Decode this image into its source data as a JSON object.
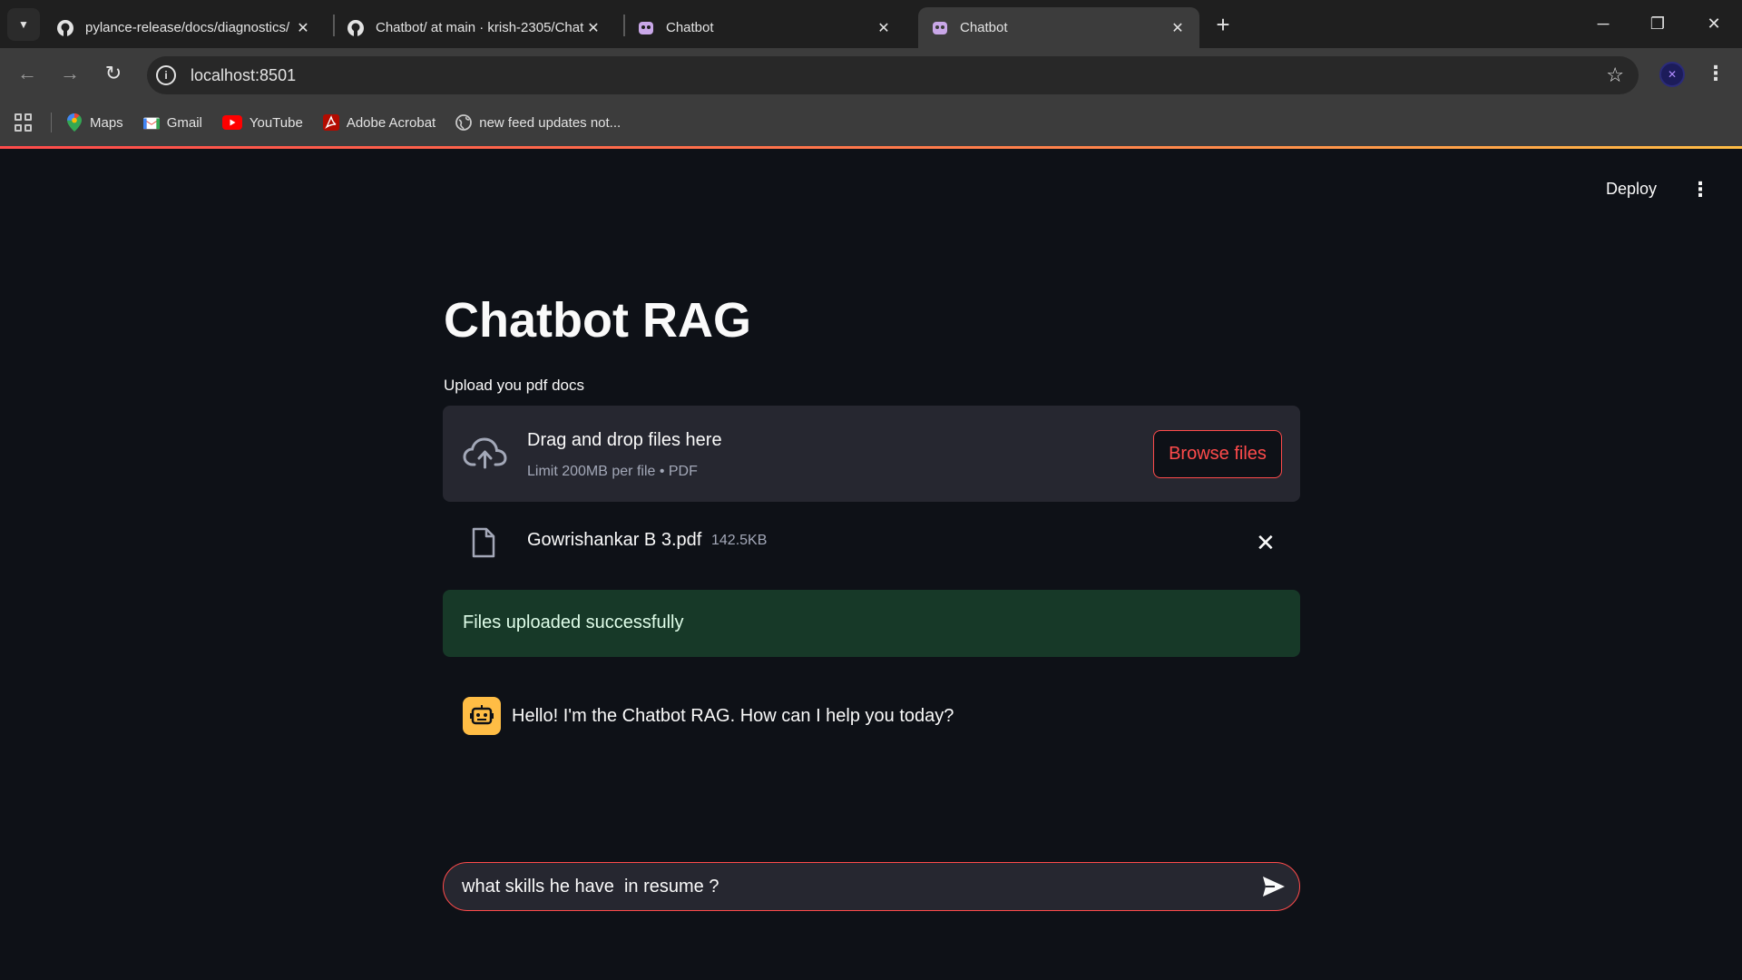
{
  "browser": {
    "tabs": [
      {
        "title": "pylance-release/docs/diagnostics/",
        "icon": "github-icon",
        "active": false
      },
      {
        "title": "Chatbot/ at main · krish-2305/Chat",
        "icon": "github-icon",
        "active": false
      },
      {
        "title": "Chatbot",
        "icon": "chatbot-icon",
        "active": false
      },
      {
        "title": "Chatbot",
        "icon": "chatbot-icon",
        "active": true
      }
    ],
    "address": "localhost:8501",
    "bookmarks": [
      {
        "label": "Maps",
        "icon": "maps-icon"
      },
      {
        "label": "Gmail",
        "icon": "gmail-icon"
      },
      {
        "label": "YouTube",
        "icon": "youtube-icon"
      },
      {
        "label": "Adobe Acrobat",
        "icon": "acrobat-icon"
      },
      {
        "label": "new feed updates not...",
        "icon": "globe-icon"
      }
    ]
  },
  "app": {
    "header": {
      "deploy_label": "Deploy"
    },
    "title": "Chatbot RAG",
    "uploader": {
      "label": "Upload you pdf docs",
      "drop_title": "Drag and drop files here",
      "drop_subtitle": "Limit 200MB per file • PDF",
      "browse_label": "Browse files"
    },
    "file": {
      "name": "Gowrishankar B 3.pdf",
      "size": "142.5KB"
    },
    "alert": {
      "text": "Files uploaded successfully",
      "color": "#173928"
    },
    "messages": [
      {
        "role": "assistant",
        "text": "Hello! I'm the Chatbot RAG. How can I help you today?"
      }
    ],
    "chat_input": {
      "value": "what skills he have  in resume ?"
    },
    "colors": {
      "accent": "#ff4b4b",
      "background": "#0e1117",
      "surface": "#262730",
      "bot_avatar": "#ffbd45"
    }
  }
}
